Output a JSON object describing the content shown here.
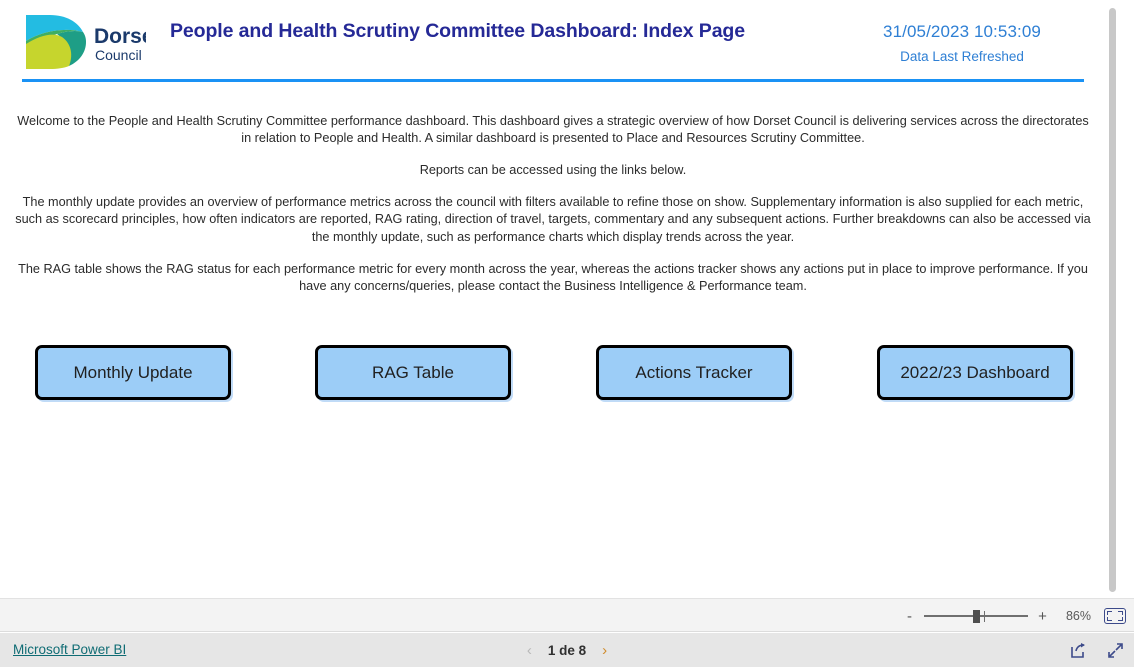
{
  "header": {
    "logo_icon": "dorset-council-logo",
    "logo_name_line1": "Dorset",
    "logo_name_line2": "Council",
    "title": "People and Health Scrutiny Committee Dashboard: Index Page",
    "refresh_time": "31/05/2023 10:53:09",
    "refresh_label": "Data Last Refreshed",
    "rule_color": "#1A92F5",
    "title_color": "#252996",
    "refresh_color": "#2E7FD4"
  },
  "body": {
    "paragraph_1": "Welcome to the People and Health Scrutiny Committee performance dashboard. This dashboard gives a strategic overview of how Dorset Council is delivering services across the directorates in relation to People and Health. A similar dashboard is presented to Place and Resources Scrutiny Committee.",
    "paragraph_2": "Reports can be accessed using the links below.",
    "paragraph_3": "The monthly update provides an overview of performance metrics across the council with filters available to refine those on show. Supplementary information is also supplied for each metric, such as scorecard principles, how often indicators are reported, RAG rating, direction of travel, targets, commentary and any subsequent actions. Further breakdowns can also be accessed via the monthly update, such as performance charts which display trends across the year.",
    "paragraph_4": "The RAG table shows the RAG status for each performance metric for every month across the year, whereas the actions tracker shows any actions put in place to improve performance. If you have any concerns/queries, please contact the Business Intelligence & Performance team."
  },
  "nav_buttons": [
    {
      "label": "Monthly Update"
    },
    {
      "label": "RAG Table"
    },
    {
      "label": "Actions Tracker"
    },
    {
      "label": "2022/23 Dashboard"
    }
  ],
  "nav_style": {
    "fill": "#9CCDF7",
    "border": "#000000",
    "text_color": "#212121"
  },
  "zoom_bar": {
    "minus_label": "-",
    "plus_label": "+",
    "zoom_level": "86%",
    "fit_icon": "fit-to-screen-icon",
    "slider_name": "zoom-slider"
  },
  "status_bar": {
    "powerbi_link": "Microsoft Power BI",
    "prev_icon": "chevron-left-icon",
    "next_icon": "chevron-right-icon",
    "page_label": "1 de 8",
    "share_icon": "share-icon",
    "fullscreen_icon": "fullscreen-icon"
  }
}
